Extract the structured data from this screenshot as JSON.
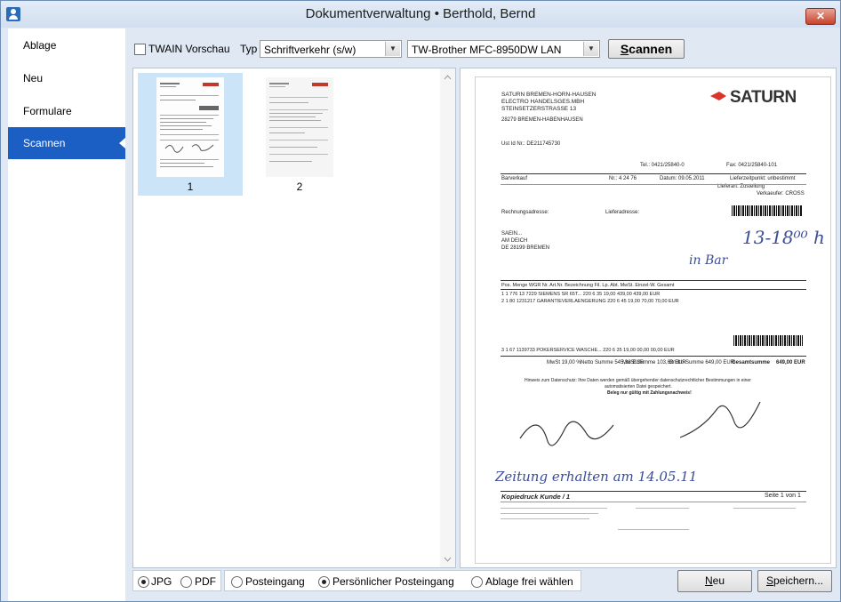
{
  "window": {
    "title": "Dokumentverwaltung  •  Berthold, Bernd",
    "close_label": "✕"
  },
  "sidebar": {
    "items": [
      {
        "label": "Ablage",
        "active": false
      },
      {
        "label": "Neu",
        "active": false
      },
      {
        "label": "Formulare",
        "active": false
      },
      {
        "label": "Scannen",
        "active": true
      }
    ]
  },
  "toolbar": {
    "twain_label": "TWAIN Vorschau",
    "twain_checked": false,
    "type_label": "Typ",
    "type_value": "Schriftverkehr (s/w)",
    "scanner_value": "TW-Brother MFC-8950DW LAN",
    "scan_button_prefix": "S",
    "scan_button_rest": "cannen"
  },
  "thumbnails": [
    {
      "number": "1",
      "selected": true
    },
    {
      "number": "2",
      "selected": false
    }
  ],
  "document": {
    "vendor_line1": "SATURN BREMEN-HORN-HAUSEN",
    "vendor_line2": "ELECTRO HANDELSGES.MBH",
    "vendor_line3": "STEINSETZERSTRASSE 13",
    "vendor_line4": "28279 BREMEN-HABENHAUSEN",
    "logo": "SATURN",
    "ust_id": "Ust Id Nr.: DE211745730",
    "tel": "Tel.: 0421/25840-0",
    "fax": "Fax: 0421/25840-101",
    "verkauf": "Barverkauf",
    "nr": "Nr.: 4 24 76",
    "datum": "Datum: 09.05.2011",
    "lieferzeit": "Lieferzeitpunkt: unbestimmt",
    "lieferart": "Lieferart: Zustellung",
    "verkaeufer": "Verkaeufer: CROSS",
    "rechnung": "Rechnungsadresse:",
    "lieferadresse": "Lieferadresse:",
    "addr1": "SAEIN...",
    "addr2": "AM DEICH",
    "addr3": "DE 28199 BREMEN",
    "table_header": "Pos. Menge WGR Nr.   Art.Nr. Bezeichnung          Fil.   Lp.  Abt.  MwSt.  Einzel-W.        Gesamt",
    "row1": "1    1   776   13 7229  SIEMENS SR 65T...        220   6    35   19,00   439,00        439,00 EUR",
    "row2": "2    1   80   1231217  GARANTIEVERLAENGERUNG      220   6    45   19,00   70,00          70,00 EUR",
    "row3": "3    1   67  1139733  POKERSERVICE WASCHE...    220   6    35   19,00   00,00          00,00 EUR",
    "mwst": "MwSt 19,00 %",
    "netto": "Netto Summe 545,38 EUR",
    "mwst_summe": "MwSt.Summe 103,62 EUR",
    "brutto": "Brutto-Summe 649,00 EUR",
    "gesamt_label": "Gesamtsumme",
    "gesamt": "649,00 EUR",
    "hinweis": "Hinweis zum Datenschutz: Ihre Daten werden gemäß übergehender datenschutzrechtlicher Bestimmungen in einer",
    "hinweis2": "automatisierten Datei gespeichert.",
    "hinweis3": "Beleg nur gültig mit Zahlungsnachweis!",
    "kopie": "Kopiedruck Kunde / 1",
    "seite": "Seite 1 von 1",
    "hand1": "13-18⁰⁰ h",
    "hand2": "in Bar",
    "hand3": "Zeitung erhalten am 14.05.11"
  },
  "bottom": {
    "format_jpg": "JPG",
    "format_pdf": "PDF",
    "jpg_selected": true,
    "dest_posteingang": "Posteingang",
    "dest_persoenlich": "Persönlicher Posteingang",
    "dest_ablage": "Ablage frei wählen",
    "selected_dest": "Persönlicher Posteingang",
    "new_prefix": "N",
    "new_rest": "eu",
    "save_prefix": "S",
    "save_rest": "peichern..."
  }
}
